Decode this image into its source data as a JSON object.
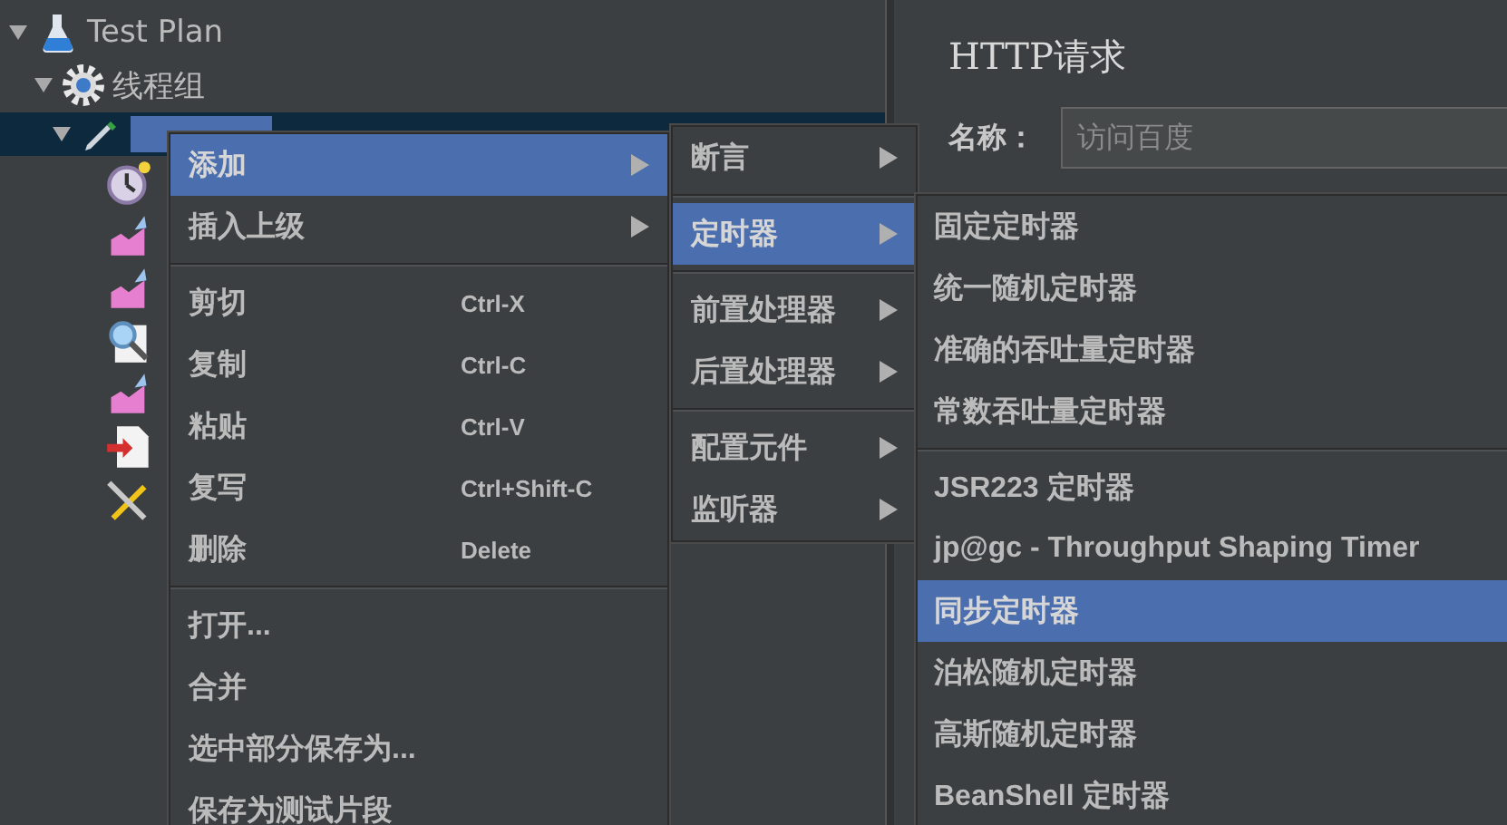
{
  "tree": {
    "label": "Test Plan",
    "expanded": true,
    "children": [
      {
        "label": "线程组",
        "expanded": true,
        "children": [
          {
            "expanded": true,
            "selected": true,
            "children": [
              {
                "kind": "timer"
              },
              {
                "kind": "graph"
              },
              {
                "kind": "graph"
              },
              {
                "kind": "magnifier"
              },
              {
                "kind": "graph"
              },
              {
                "kind": "import"
              },
              {
                "kind": "tools"
              }
            ]
          }
        ]
      }
    ]
  },
  "context_menu": {
    "items": [
      {
        "kind": "submenu",
        "label": "添加",
        "selected": true
      },
      {
        "kind": "submenu",
        "label": "插入上级",
        "selected": false
      },
      {
        "kind": "separator"
      },
      {
        "kind": "action",
        "label": "剪切",
        "shortcut": "Ctrl-X",
        "selected": false
      },
      {
        "kind": "action",
        "label": "复制",
        "shortcut": "Ctrl-C",
        "selected": false
      },
      {
        "kind": "action",
        "label": "粘贴",
        "shortcut": "Ctrl-V",
        "selected": false
      },
      {
        "kind": "action",
        "label": "复写",
        "shortcut": "Ctrl+Shift-C",
        "selected": false
      },
      {
        "kind": "action",
        "label": "删除",
        "shortcut": "Delete",
        "selected": false
      },
      {
        "kind": "separator"
      },
      {
        "kind": "action",
        "label": "打开...",
        "selected": false
      },
      {
        "kind": "action",
        "label": "合并",
        "selected": false
      },
      {
        "kind": "action",
        "label": "选中部分保存为...",
        "selected": false
      },
      {
        "kind": "action",
        "label": "保存为测试片段",
        "selected": false
      }
    ]
  },
  "add_submenu": {
    "items": [
      {
        "kind": "submenu",
        "label": "断言",
        "selected": false
      },
      {
        "kind": "separator"
      },
      {
        "kind": "submenu",
        "label": "定时器",
        "selected": true
      },
      {
        "kind": "separator"
      },
      {
        "kind": "submenu",
        "label": "前置处理器",
        "selected": false
      },
      {
        "kind": "submenu",
        "label": "后置处理器",
        "selected": false
      },
      {
        "kind": "separator"
      },
      {
        "kind": "submenu",
        "label": "配置元件",
        "selected": false
      },
      {
        "kind": "submenu",
        "label": "监听器",
        "selected": false
      }
    ]
  },
  "timer_submenu": {
    "items": [
      {
        "kind": "action",
        "label": "固定定时器",
        "selected": false
      },
      {
        "kind": "action",
        "label": "统一随机定时器",
        "selected": false
      },
      {
        "kind": "action",
        "label": "准确的吞吐量定时器",
        "selected": false
      },
      {
        "kind": "action",
        "label": "常数吞吐量定时器",
        "selected": false
      },
      {
        "kind": "separator"
      },
      {
        "kind": "action",
        "label": "JSR223 定时器",
        "selected": false
      },
      {
        "kind": "action",
        "label": "jp@gc - Throughput Shaping Timer",
        "selected": false
      },
      {
        "kind": "action",
        "label": "同步定时器",
        "selected": true
      },
      {
        "kind": "action",
        "label": "泊松随机定时器",
        "selected": false
      },
      {
        "kind": "action",
        "label": "高斯随机定时器",
        "selected": false
      },
      {
        "kind": "action",
        "label": "BeanShell 定时器",
        "selected": false
      }
    ]
  },
  "panel": {
    "title": "HTTP请求",
    "name_label": "名称：",
    "name_value": "访问百度"
  }
}
